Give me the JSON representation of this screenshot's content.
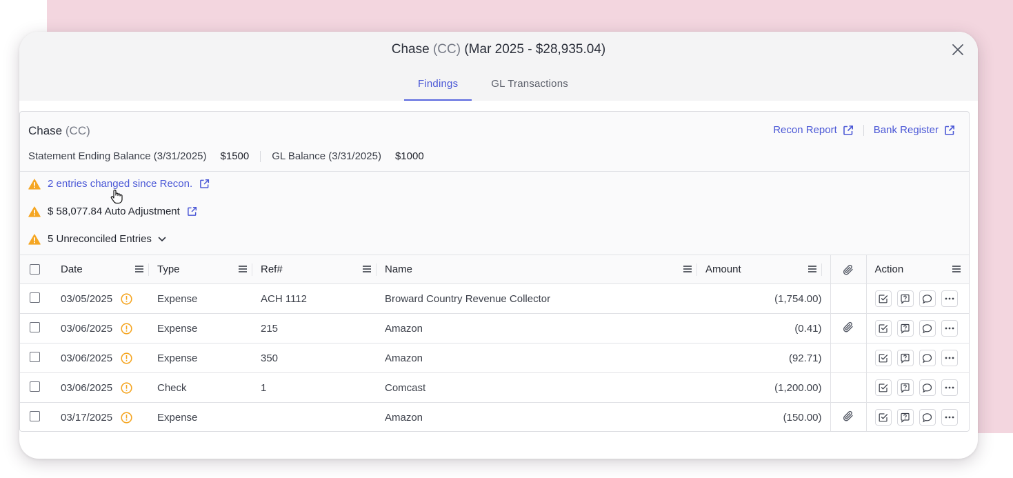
{
  "modal": {
    "title_main": "Chase",
    "title_type": "(CC)",
    "title_period": "(Mar 2025 - $28,935.04)",
    "tabs": [
      {
        "label": "Findings",
        "active": true
      },
      {
        "label": "GL Transactions",
        "active": false
      }
    ]
  },
  "account": {
    "name": "Chase",
    "type": "(CC)",
    "links": [
      {
        "label": "Recon Report",
        "icon": "external-link-icon"
      },
      {
        "label": "Bank Register",
        "icon": "external-link-icon"
      }
    ],
    "statement_label": "Statement Ending Balance (3/31/2025)",
    "statement_value": "$1500",
    "gl_label": "GL Balance (3/31/2025)",
    "gl_value": "$1000"
  },
  "findings": [
    {
      "text": "2 entries changed since Recon.",
      "icon": "warning-icon",
      "link": true
    },
    {
      "text": "$ 58,077.84 Auto Adjustment",
      "icon": "warning-icon",
      "link": false
    },
    {
      "text": "5 Unreconciled Entries",
      "icon": "warning-icon",
      "expandable": true
    }
  ],
  "table": {
    "columns": {
      "date": "Date",
      "type": "Type",
      "ref": "Ref#",
      "name": "Name",
      "amount": "Amount",
      "action": "Action"
    },
    "rows": [
      {
        "date": "03/05/2025",
        "type": "Expense",
        "ref": "ACH 1112",
        "name": "Broward Country Revenue Collector",
        "amount": "(1,754.00)",
        "attachment": false
      },
      {
        "date": "03/06/2025",
        "type": "Expense",
        "ref": "215",
        "name": "Amazon",
        "amount": "(0.41)",
        "attachment": true
      },
      {
        "date": "03/06/2025",
        "type": "Expense",
        "ref": "350",
        "name": "Amazon",
        "amount": "(92.71)",
        "attachment": false
      },
      {
        "date": "03/06/2025",
        "type": "Check",
        "ref": "1",
        "name": "Comcast",
        "amount": "(1,200.00)",
        "attachment": false
      },
      {
        "date": "03/17/2025",
        "type": "Expense",
        "ref": "",
        "name": "Amazon",
        "amount": "(150.00)",
        "attachment": true
      }
    ]
  },
  "colors": {
    "accent": "#4a57d6",
    "warning": "#f5a623",
    "background_pink": "#f3d6df"
  }
}
